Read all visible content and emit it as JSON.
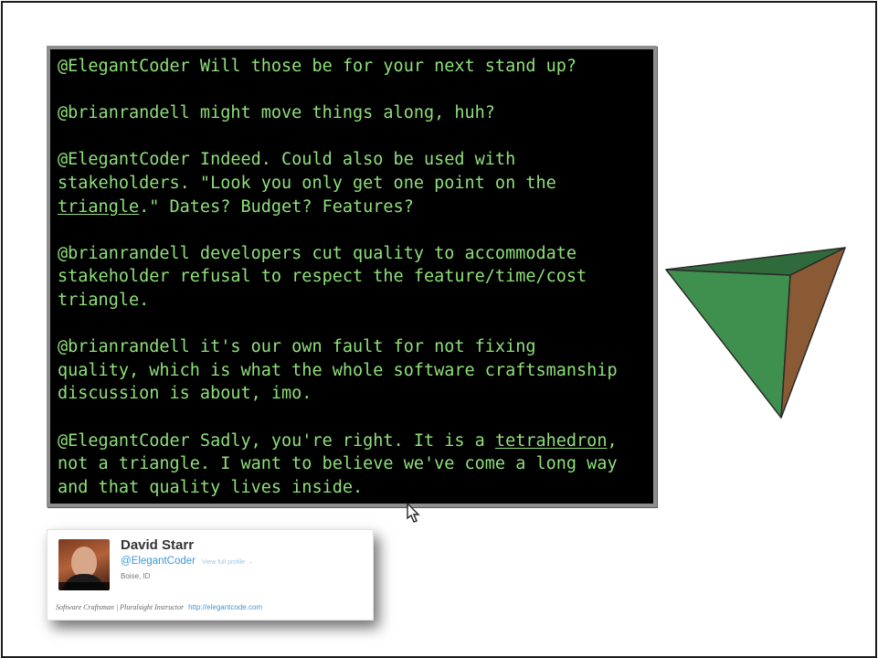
{
  "terminal": {
    "lines": [
      {
        "pre": "@ElegantCoder Will those be for your next stand up?"
      },
      {
        "blank": true
      },
      {
        "pre": "@brianrandell might move things along, huh?"
      },
      {
        "blank": true
      },
      {
        "pre": "@ElegantCoder Indeed. Could also be used with"
      },
      {
        "pre": "stakeholders. \"Look you only get one point on the"
      },
      {
        "pre": "",
        "link": "triangle",
        "post": ".\" Dates? Budget? Features?"
      },
      {
        "blank": true
      },
      {
        "pre": "@brianrandell developers cut quality to accommodate"
      },
      {
        "pre": "stakeholder refusal to respect the feature/time/cost"
      },
      {
        "pre": "triangle."
      },
      {
        "blank": true
      },
      {
        "pre": "@brianrandell it's our own fault for not fixing"
      },
      {
        "pre": "quality, which is what the whole software craftsmanship"
      },
      {
        "pre": "discussion is about, imo."
      },
      {
        "blank": true
      },
      {
        "pre": "@ElegantCoder Sadly, you're right. It is a ",
        "link": "tetrahedron",
        "post": ","
      },
      {
        "pre": "not a triangle. I want to believe we've come a long way"
      },
      {
        "pre": "and that quality lives inside."
      }
    ]
  },
  "profile": {
    "name": "David Starr",
    "handle": "@ElegantCoder",
    "view_profile": "View full profile →",
    "location": "Boise, ID",
    "bio": "Software Craftsman | Pluralsight Instructor",
    "url": "http://elegantcode.com"
  },
  "colors": {
    "terminal_text": "#8fe07a",
    "tetra_front": "#3f8f4f",
    "tetra_side": "#8a5a35",
    "link_blue": "#3b9ad9"
  }
}
